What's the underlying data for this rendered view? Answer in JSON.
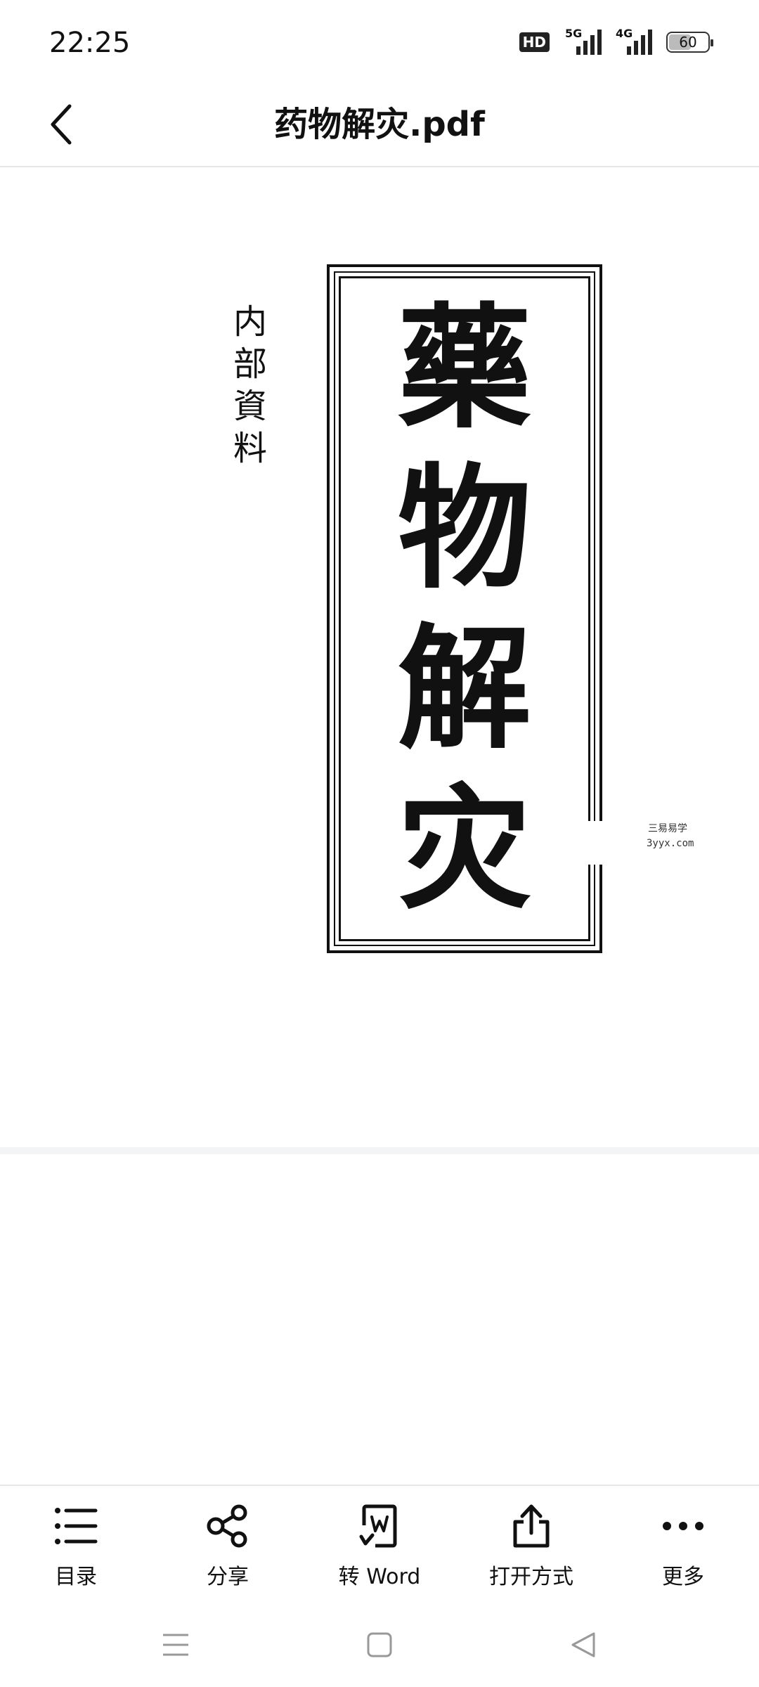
{
  "status": {
    "time": "22:25",
    "hd": "HD",
    "net1": "5G",
    "net2": "4G",
    "battery": "60",
    "battery_level": 0.6
  },
  "header": {
    "title": "药物解灾.pdf",
    "back_icon": "chevron-left-icon"
  },
  "document": {
    "side_label_chars": [
      "内",
      "部",
      "資",
      "料"
    ],
    "title_chars": [
      "藥",
      "物",
      "解",
      "灾"
    ],
    "watermark_line1": "三易易学",
    "watermark_line2": "3yyx.com"
  },
  "toolbar": {
    "items": [
      {
        "label": "目录",
        "icon": "list-icon"
      },
      {
        "label": "分享",
        "icon": "share-icon"
      },
      {
        "label": "转 Word",
        "icon": "word-icon"
      },
      {
        "label": "打开方式",
        "icon": "open-with-icon"
      },
      {
        "label": "更多",
        "icon": "more-icon"
      }
    ]
  },
  "nav": {
    "items": [
      "menu-icon",
      "home-icon",
      "back-triangle-icon"
    ]
  }
}
